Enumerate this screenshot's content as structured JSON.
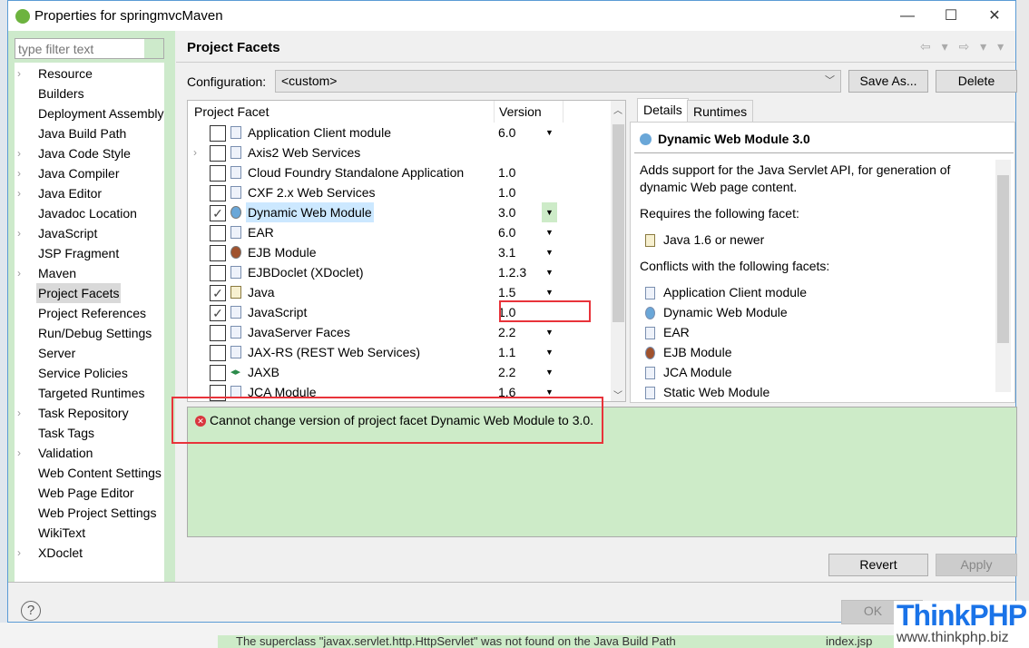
{
  "window": {
    "title": "Properties for springmvcMaven",
    "controls": [
      "—",
      "☐",
      "✕"
    ]
  },
  "filter": {
    "placeholder": "type filter text"
  },
  "sidebar": {
    "items": [
      {
        "label": "Resource",
        "expandable": true
      },
      {
        "label": "Builders"
      },
      {
        "label": "Deployment Assembly"
      },
      {
        "label": "Java Build Path"
      },
      {
        "label": "Java Code Style",
        "expandable": true
      },
      {
        "label": "Java Compiler",
        "expandable": true
      },
      {
        "label": "Java Editor",
        "expandable": true
      },
      {
        "label": "Javadoc Location"
      },
      {
        "label": "JavaScript",
        "expandable": true
      },
      {
        "label": "JSP Fragment"
      },
      {
        "label": "Maven",
        "expandable": true
      },
      {
        "label": "Project Facets",
        "selected": true
      },
      {
        "label": "Project References"
      },
      {
        "label": "Run/Debug Settings"
      },
      {
        "label": "Server"
      },
      {
        "label": "Service Policies"
      },
      {
        "label": "Targeted Runtimes"
      },
      {
        "label": "Task Repository",
        "expandable": true
      },
      {
        "label": "Task Tags"
      },
      {
        "label": "Validation",
        "expandable": true
      },
      {
        "label": "Web Content Settings"
      },
      {
        "label": "Web Page Editor"
      },
      {
        "label": "Web Project Settings"
      },
      {
        "label": "WikiText"
      },
      {
        "label": "XDoclet",
        "expandable": true
      }
    ]
  },
  "page": {
    "title": "Project Facets",
    "nav_icons": "⇦ ▾ ⇨ ▾ ▾"
  },
  "config": {
    "label": "Configuration:",
    "value": "<custom>",
    "save_as": "Save As...",
    "delete": "Delete"
  },
  "facets": {
    "col_facet": "Project Facet",
    "col_version": "Version",
    "rows": [
      {
        "name": "Application Client module",
        "version": "6.0",
        "dropdown": true,
        "checked": false,
        "icon": "doc"
      },
      {
        "name": "Axis2 Web Services",
        "version": "",
        "checked": false,
        "icon": "doc",
        "expandable": true
      },
      {
        "name": "Cloud Foundry Standalone Application",
        "version": "1.0",
        "checked": false,
        "icon": "doc"
      },
      {
        "name": "CXF 2.x Web Services",
        "version": "1.0",
        "checked": false,
        "icon": "doc"
      },
      {
        "name": "Dynamic Web Module",
        "version": "3.0",
        "dropdown": true,
        "checked": true,
        "icon": "globe",
        "selected": true
      },
      {
        "name": "EAR",
        "version": "6.0",
        "dropdown": true,
        "checked": false,
        "icon": "doc"
      },
      {
        "name": "EJB Module",
        "version": "3.1",
        "dropdown": true,
        "checked": false,
        "icon": "bean"
      },
      {
        "name": "EJBDoclet (XDoclet)",
        "version": "1.2.3",
        "dropdown": true,
        "checked": false,
        "icon": "doc"
      },
      {
        "name": "Java",
        "version": "1.5",
        "dropdown": true,
        "checked": true,
        "icon": "java"
      },
      {
        "name": "JavaScript",
        "version": "1.0",
        "checked": true,
        "icon": "doc"
      },
      {
        "name": "JavaServer Faces",
        "version": "2.2",
        "dropdown": true,
        "checked": false,
        "icon": "doc"
      },
      {
        "name": "JAX-RS (REST Web Services)",
        "version": "1.1",
        "dropdown": true,
        "checked": false,
        "icon": "doc"
      },
      {
        "name": "JAXB",
        "version": "2.2",
        "dropdown": true,
        "checked": false,
        "icon": "jaxb"
      },
      {
        "name": "JCA Module",
        "version": "1.6",
        "dropdown": true,
        "checked": false,
        "icon": "doc"
      }
    ]
  },
  "tabs": {
    "details": "Details",
    "runtimes": "Runtimes"
  },
  "details": {
    "title": "Dynamic Web Module 3.0",
    "desc1": "Adds support for the Java Servlet API, for generation of",
    "desc2": "dynamic Web page content.",
    "requires_label": "Requires the following facet:",
    "requires": [
      {
        "name": "Java 1.6 or newer",
        "icon": "java"
      }
    ],
    "conflicts_label": "Conflicts with the following facets:",
    "conflicts": [
      {
        "name": "Application Client module",
        "icon": "doc"
      },
      {
        "name": "Dynamic Web Module",
        "icon": "globe"
      },
      {
        "name": "EAR",
        "icon": "doc"
      },
      {
        "name": "EJB Module",
        "icon": "bean"
      },
      {
        "name": "JCA Module",
        "icon": "doc"
      },
      {
        "name": "Static Web Module",
        "icon": "doc"
      }
    ]
  },
  "error": {
    "message": "Cannot change version of project facet Dynamic Web Module to 3.0."
  },
  "buttons": {
    "revert": "Revert",
    "apply": "Apply",
    "ok": "OK",
    "help": "?"
  },
  "background": {
    "error_text": "The superclass \"javax.servlet.http.HttpServlet\" was not found on the Java Build Path",
    "file": "index.jsp"
  },
  "watermark": {
    "brand": "ThinkPHP",
    "url": "www.thinkphp.biz"
  },
  "colors": {
    "accent_green": "#cdeacb",
    "highlight_red": "#e8333a",
    "selection": "#cce8ff",
    "brand_blue": "#1a73e8"
  }
}
